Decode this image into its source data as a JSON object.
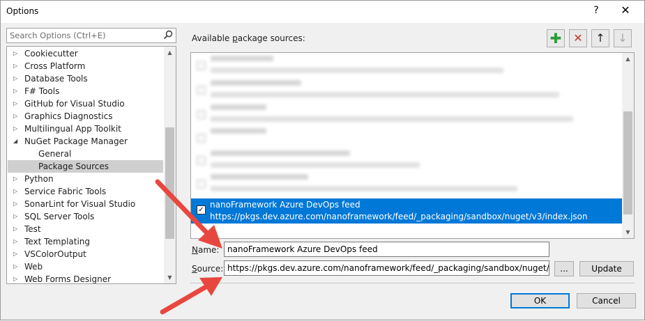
{
  "window": {
    "title": "Options",
    "help_glyph": "?",
    "close_glyph": "✕"
  },
  "search": {
    "placeholder": "Search Options (Ctrl+E)",
    "value": ""
  },
  "tree": {
    "items": [
      {
        "label": "Cookiecutter",
        "expanded": false
      },
      {
        "label": "Cross Platform",
        "expanded": false
      },
      {
        "label": "Database Tools",
        "expanded": false
      },
      {
        "label": "F# Tools",
        "expanded": false
      },
      {
        "label": "GitHub for Visual Studio",
        "expanded": false
      },
      {
        "label": "Graphics Diagnostics",
        "expanded": false
      },
      {
        "label": "Multilingual App Toolkit",
        "expanded": false
      },
      {
        "label": "NuGet Package Manager",
        "expanded": true
      },
      {
        "label": "General",
        "child": true
      },
      {
        "label": "Package Sources",
        "child": true,
        "selected": true
      },
      {
        "label": "Python",
        "expanded": false
      },
      {
        "label": "Service Fabric Tools",
        "expanded": false
      },
      {
        "label": "SonarLint for Visual Studio",
        "expanded": false
      },
      {
        "label": "SQL Server Tools",
        "expanded": false
      },
      {
        "label": "Test",
        "expanded": false
      },
      {
        "label": "Text Templating",
        "expanded": false
      },
      {
        "label": "VSColorOutput",
        "expanded": false
      },
      {
        "label": "Web",
        "expanded": false
      },
      {
        "label": "Web Forms Designer",
        "expanded": false
      }
    ]
  },
  "sources": {
    "label_prefix": "Available ",
    "label_accel": "p",
    "label_suffix": "ackage sources:",
    "toolbar": {
      "add_icon": "plus-icon",
      "remove_icon": "x-icon",
      "up_icon": "arrow-up-icon",
      "down_icon": "arrow-down-icon"
    },
    "selected": {
      "name": "nanoFramework Azure DevOps feed",
      "url": "https://pkgs.dev.azure.com/nanoframework/feed/_packaging/sandbox/nuget/v3/index.json",
      "checked": true
    }
  },
  "form": {
    "name_accel": "N",
    "name_label_rest": "ame:",
    "name_value": "nanoFramework Azure DevOps feed",
    "source_accel": "S",
    "source_label_rest": "ource:",
    "source_value": "https://pkgs.dev.azure.com/nanoframework/feed/_packaging/sandbox/nuget/v3/index.json",
    "browse_label": "...",
    "update_label": "Update"
  },
  "footer": {
    "ok_label": "OK",
    "cancel_label": "Cancel"
  },
  "colors": {
    "selection": "#0078d7",
    "annotation_arrow": "#e8473f",
    "add_green": "#2e9a3a",
    "remove_red": "#c0392b"
  }
}
